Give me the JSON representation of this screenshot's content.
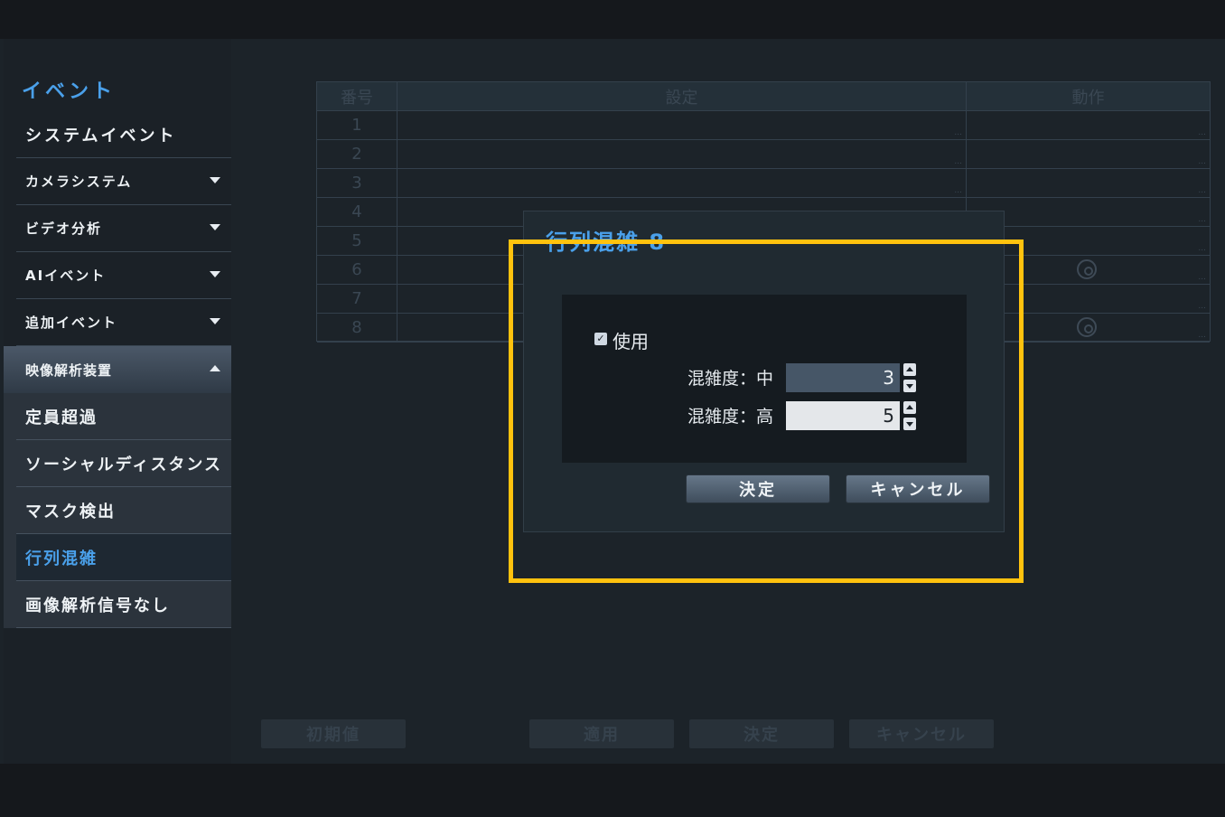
{
  "sidebar": {
    "title": "イベント",
    "items": [
      {
        "label": "システムイベント",
        "has_arrow": false
      },
      {
        "label": "カメラシステム",
        "has_arrow": true
      },
      {
        "label": "ビデオ分析",
        "has_arrow": true
      },
      {
        "label": "AIイベント",
        "has_arrow": true
      },
      {
        "label": "追加イベント",
        "has_arrow": true
      }
    ],
    "group": {
      "label": "映像解析装置",
      "expanded": true
    },
    "sub_items": [
      {
        "label": "定員超過"
      },
      {
        "label": "ソーシャルディスタンス"
      },
      {
        "label": "マスク検出"
      },
      {
        "label": "行列混雑",
        "active": true
      },
      {
        "label": "画像解析信号なし"
      }
    ]
  },
  "table": {
    "headers": [
      "番号",
      "設定",
      "動作"
    ],
    "rows": [
      "1",
      "2",
      "3",
      "4",
      "5",
      "6",
      "7",
      "8"
    ],
    "ellipsis": "..."
  },
  "bottom_buttons": {
    "default": "初期値",
    "apply": "適用",
    "ok": "決定",
    "cancel": "キャンセル"
  },
  "dialog": {
    "title": "行列混雑 8",
    "use_label": "使用",
    "use_checked": true,
    "checkmark": "✓",
    "mid_label": "混雑度：中",
    "mid_value": "3",
    "high_label": "混雑度：高",
    "high_value": "5",
    "ok": "決定",
    "cancel": "キャンセル"
  },
  "colors": {
    "accent": "#4aa0ea",
    "highlight": "#ffc20e"
  }
}
